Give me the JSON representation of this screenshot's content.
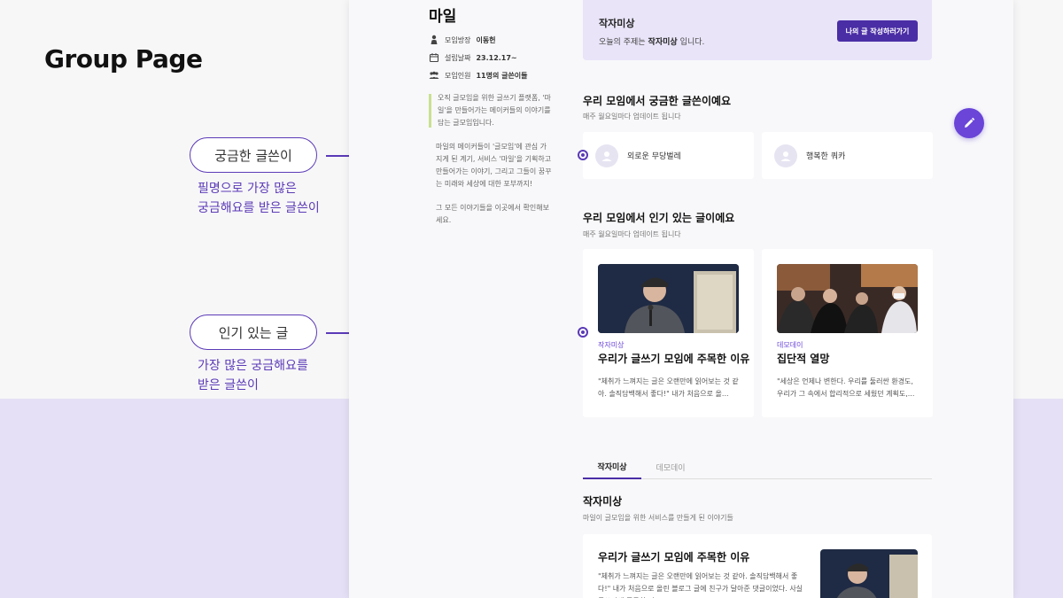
{
  "board": {
    "title": "Group Page",
    "annotations": [
      {
        "pill": "궁금한 글쓴이",
        "desc_line1": "필명으로 가장 많은",
        "desc_line2": "궁금해요를 받은 글쓴이"
      },
      {
        "pill": "인기 있는 글",
        "desc_line1": "가장 많은 궁금해요를",
        "desc_line2": "받은 글쓴이"
      }
    ]
  },
  "group": {
    "name": "마일",
    "meta": [
      {
        "icon": "person-icon",
        "label": "모임방장",
        "value": "이동헌"
      },
      {
        "icon": "calendar-icon",
        "label": "설립날짜",
        "value": "23.12.17~"
      },
      {
        "icon": "people-icon",
        "label": "모임인원",
        "value": "11명의 글쓴이들"
      }
    ],
    "intro": [
      "오직 글모임을 위한 글쓰기 플랫폼, '마일'을 만들어가는 메이커들의 이야기를 담는 글모임입니다.",
      "마일의 메이커들이 '글모임'에 관심 가지게 된 계기, 서비스 '마일'을 기획하고 만들어가는 이야기, 그리고 그들이 꿈꾸는 미래와 세상에 대한 포부까지!",
      "그 모든 이야기들을 이곳에서 확인해보세요."
    ]
  },
  "topic": {
    "title": "작자미상",
    "desc_prefix": "오늘의 주제는",
    "desc_topic": "작자미상",
    "desc_suffix": "입니다.",
    "button": "나의 글 작성하러가기"
  },
  "curious_writers": {
    "title": "우리 모임에서 궁금한 글쓴이예요",
    "subtitle": "매주 월요일마다 업데이트 됩니다",
    "writers": [
      "외로운 무당벌레",
      "행복한 쿼카"
    ]
  },
  "popular_posts": {
    "title": "우리 모임에서 인기 있는 글이에요",
    "subtitle": "매주 월요일마다 업데이트 됩니다",
    "posts": [
      {
        "category": "작자미상",
        "title": "우리가 글쓰기 모임에 주목한 이유",
        "snippet": "\"체취가 느껴지는 글은 오랜만에 읽어보는 것 같아. 솔직담백해서 좋다!\" 내가 처음으로 올..."
      },
      {
        "category": "데모데이",
        "title": "집단적 열망",
        "snippet": "\"세상은 언제나 변한다. 우리를 둘러싼 환경도, 우리가 그 속에서 합리적으로 세웠던 계획도,..."
      }
    ]
  },
  "tabs": [
    "작자미상",
    "데모데이"
  ],
  "topic_section": {
    "title": "작자미상",
    "subtitle": "마일이 글모임을 위한 서비스를 만들게 된 이야기들"
  },
  "list_post": {
    "title": "우리가 글쓰기 모임에 주목한 이유",
    "snippet": "\"체취가 느껴지는 글은 오랜만에 읽어보는 것 같아. 솔직담백해서 좋다!\"   내가 처음으로 올린 블로그 글에 친구가 달아준 댓글이었다. 사실 글쓰기에 주목한 것"
  },
  "colors": {
    "accent": "#5b3ab7",
    "button": "#4a2ea5",
    "fab": "#6a45d8",
    "topic_bg": "#e9e4f8",
    "lower_bg": "#e6e0f6"
  }
}
